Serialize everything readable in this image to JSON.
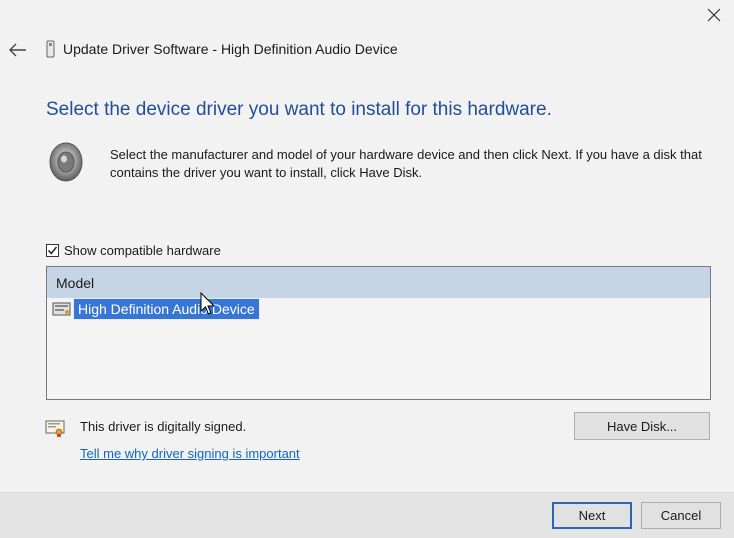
{
  "window": {
    "title": "Update Driver Software - High Definition Audio Device",
    "close_icon": "close-icon",
    "back_icon": "back-arrow-icon",
    "title_icon": "device-icon"
  },
  "main": {
    "heading": "Select the device driver you want to install for this hardware.",
    "description": "Select the manufacturer and model of your hardware device and then click Next. If you have a disk that contains the driver you want to install, click Have Disk.",
    "speaker_icon": "speaker-icon"
  },
  "compatible": {
    "label": "Show compatible hardware",
    "checked": true
  },
  "model_list": {
    "header": "Model",
    "items": [
      {
        "label": "High Definition Audio Device",
        "selected": true
      }
    ]
  },
  "signing": {
    "status": "This driver is digitally signed.",
    "link": "Tell me why driver signing is important",
    "icon": "certificate-icon"
  },
  "buttons": {
    "have_disk": "Have Disk...",
    "next": "Next",
    "cancel": "Cancel"
  },
  "colors": {
    "heading": "#1f4e9a",
    "selection": "#3876d6",
    "link": "#1464c8",
    "header_band": "#c5d5e6"
  }
}
